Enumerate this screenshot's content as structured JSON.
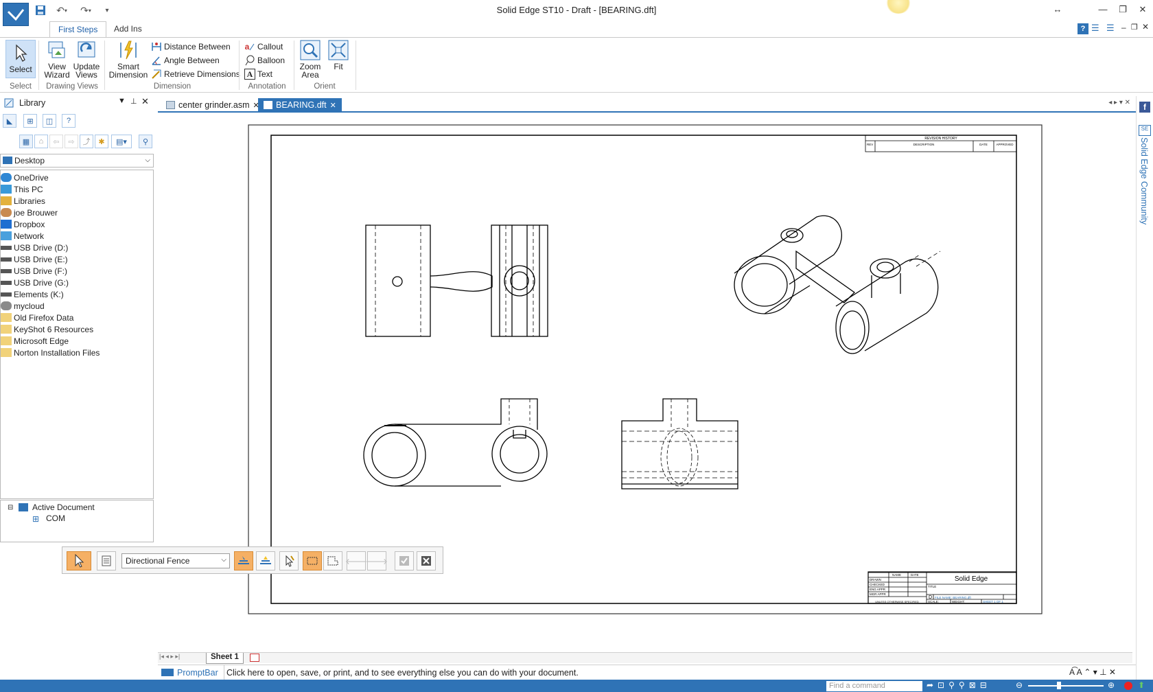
{
  "window": {
    "title": "Solid Edge ST10 - Draft - [BEARING.dft]",
    "accent": "#2f73b6"
  },
  "ribbon_tabs": [
    "First Steps",
    "Add Ins"
  ],
  "ribbon": {
    "select": "Select",
    "view_wizard_1": "View",
    "view_wizard_2": "Wizard",
    "update_views_1": "Update",
    "update_views_2": "Views",
    "smart_dim_1": "Smart",
    "smart_dim_2": "Dimension",
    "distance_between": "Distance Between",
    "angle_between": "Angle Between",
    "retrieve_dimensions": "Retrieve Dimensions",
    "callout": "Callout",
    "balloon": "Balloon",
    "text": "Text",
    "zoom_area_1": "Zoom",
    "zoom_area_2": "Area",
    "fit": "Fit",
    "groups": {
      "select": "Select",
      "drawing_views": "Drawing Views",
      "dimension": "Dimension",
      "annotation": "Annotation",
      "orient": "Orient"
    }
  },
  "library": {
    "title": "Library",
    "location": "Desktop",
    "items": [
      "OneDrive",
      "This PC",
      "Libraries",
      "joe Brouwer",
      "Dropbox",
      "Network",
      "USB Drive (D:)",
      "USB Drive (E:)",
      "USB Drive (F:)",
      "USB Drive (G:)",
      "Elements (K:)",
      "mycloud",
      "Old Firefox Data",
      "KeyShot 6 Resources",
      "Microsoft Edge",
      "Norton Installation Files"
    ],
    "tree_root": "Active Document",
    "tree_child": "COM"
  },
  "doc_tabs": [
    "center grinder.asm",
    "BEARING.dft"
  ],
  "command_bar": {
    "selection_mode": "Directional Fence"
  },
  "title_block": {
    "brand": "Solid Edge",
    "revision_history": "REVISION HISTORY",
    "rev": "REV",
    "description": "DESCRIPTION",
    "date": "DATE",
    "approved": "APPROVED",
    "name": "NAME",
    "drawn": "DRAWN",
    "checked": "CHECKED",
    "eng_appr": "ENG APPR",
    "mgr_appr": "MGR APPR",
    "size_letter": "D",
    "title": "TITLE",
    "scale": "SCALE:",
    "weight": "WEIGHT:",
    "sheet": "SHEET 1 OF 1",
    "file_name": "FILE NAME: BEARING.dft",
    "note_1": "UNLESS OTHERWISE SPECIFIED",
    "note_2": "DIMENSIONS ARE IN INCHES",
    "note_3": "ANGLES ±X.X°",
    "note_4": "2 PL ±X.XX 3 PL ±X.XXX"
  },
  "sheet_tab": "Sheet 1",
  "prompt": {
    "label": "PromptBar",
    "text": "Click here to open, save, or print, and to see everything else you can do with your document."
  },
  "status": {
    "find_placeholder": "Find a command"
  },
  "community_label": "Solid Edge Community"
}
